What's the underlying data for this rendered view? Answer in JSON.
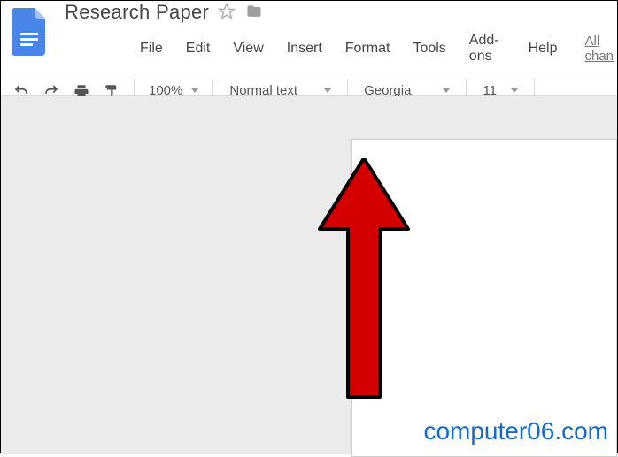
{
  "doc_title": "Research Paper",
  "menus": {
    "file": "File",
    "edit": "Edit",
    "view": "View",
    "insert": "Insert",
    "format": "Format",
    "tools": "Tools",
    "addons": "Add-ons",
    "help": "Help"
  },
  "menu_right": "All chan",
  "toolbar": {
    "zoom": "100%",
    "paragraph_style": "Normal text",
    "font": "Georgia",
    "font_size": "11"
  },
  "watermark": "computer06.com"
}
